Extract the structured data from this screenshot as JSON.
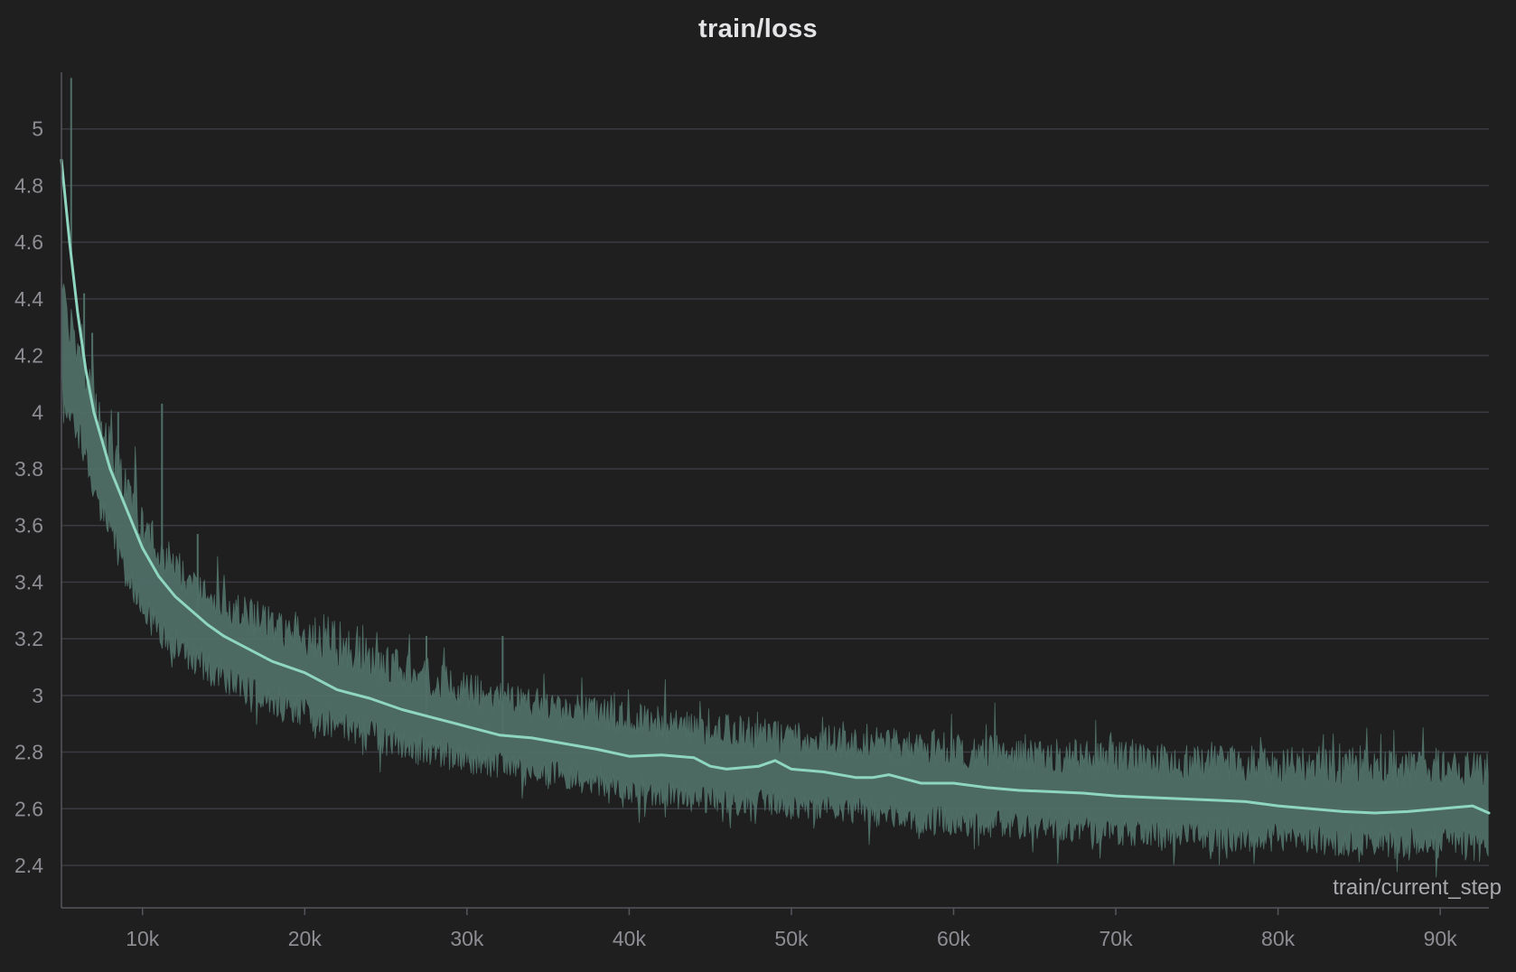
{
  "chart_data": {
    "type": "line",
    "title": "train/loss",
    "xlabel": "train/current_step",
    "ylabel": "",
    "xlim": [
      5000,
      93000
    ],
    "ylim": [
      2.25,
      5.2
    ],
    "grid": true,
    "x_ticks": [
      10000,
      20000,
      30000,
      40000,
      50000,
      60000,
      70000,
      80000,
      90000
    ],
    "x_tick_labels": [
      "10k",
      "20k",
      "30k",
      "40k",
      "50k",
      "60k",
      "70k",
      "80k",
      "90k"
    ],
    "y_ticks": [
      2.4,
      2.6,
      2.8,
      3.0,
      3.2,
      3.4,
      3.6,
      3.8,
      4.0,
      4.2,
      4.4,
      4.6,
      4.8,
      5.0
    ],
    "y_tick_labels": [
      "2.4",
      "2.6",
      "2.8",
      "3",
      "3.2",
      "3.4",
      "3.6",
      "3.8",
      "4",
      "4.2",
      "4.4",
      "4.6",
      "4.8",
      "5"
    ],
    "colors": {
      "smoothed": "#8fd6c0",
      "raw": "#4f6f66",
      "background": "#1f1f20",
      "grid": "#3a3a42"
    },
    "series": [
      {
        "role": "smoothed",
        "x": [
          5000,
          5500,
          6000,
          6500,
          7000,
          7500,
          8000,
          9000,
          10000,
          11000,
          12000,
          13000,
          14000,
          15000,
          16000,
          18000,
          20000,
          22000,
          24000,
          26000,
          28000,
          30000,
          32000,
          34000,
          36000,
          38000,
          40000,
          42000,
          44000,
          45000,
          46000,
          48000,
          49000,
          50000,
          52000,
          54000,
          55000,
          56000,
          58000,
          60000,
          62000,
          64000,
          66000,
          68000,
          70000,
          72000,
          74000,
          76000,
          78000,
          80000,
          82000,
          84000,
          86000,
          88000,
          90000,
          92000,
          93000
        ],
        "y": [
          4.89,
          4.6,
          4.35,
          4.15,
          4.0,
          3.9,
          3.8,
          3.66,
          3.52,
          3.42,
          3.35,
          3.3,
          3.25,
          3.21,
          3.18,
          3.12,
          3.08,
          3.02,
          2.99,
          2.95,
          2.92,
          2.89,
          2.86,
          2.85,
          2.83,
          2.81,
          2.785,
          2.79,
          2.78,
          2.75,
          2.74,
          2.75,
          2.77,
          2.74,
          2.73,
          2.71,
          2.71,
          2.72,
          2.69,
          2.69,
          2.675,
          2.665,
          2.66,
          2.655,
          2.645,
          2.64,
          2.635,
          2.63,
          2.625,
          2.61,
          2.6,
          2.59,
          2.585,
          2.59,
          2.6,
          2.61,
          2.585
        ]
      },
      {
        "role": "raw-band",
        "x": [
          5000,
          6000,
          7000,
          8000,
          10000,
          12000,
          15000,
          20000,
          25000,
          30000,
          35000,
          40000,
          45000,
          50000,
          55000,
          60000,
          65000,
          70000,
          75000,
          80000,
          85000,
          90000,
          93000
        ],
        "y_min": [
          4.0,
          3.88,
          3.66,
          3.52,
          3.24,
          3.12,
          3.0,
          2.88,
          2.78,
          2.72,
          2.68,
          2.62,
          2.58,
          2.56,
          2.53,
          2.5,
          2.49,
          2.47,
          2.45,
          2.44,
          2.43,
          2.42,
          2.41
        ],
        "y_max": [
          4.5,
          4.3,
          4.1,
          3.95,
          3.68,
          3.52,
          3.38,
          3.27,
          3.18,
          3.08,
          3.02,
          2.98,
          2.94,
          2.91,
          2.89,
          2.87,
          2.85,
          2.84,
          2.83,
          2.82,
          2.81,
          2.81,
          2.8
        ],
        "spikes": [
          {
            "x": 5600,
            "y": 5.18
          },
          {
            "x": 6400,
            "y": 4.42
          },
          {
            "x": 6900,
            "y": 4.28
          },
          {
            "x": 8500,
            "y": 4.0
          },
          {
            "x": 11200,
            "y": 4.03
          },
          {
            "x": 13400,
            "y": 3.57
          },
          {
            "x": 27500,
            "y": 3.21
          },
          {
            "x": 32200,
            "y": 3.21
          },
          {
            "x": 41600,
            "y": 2.78
          }
        ]
      }
    ]
  }
}
